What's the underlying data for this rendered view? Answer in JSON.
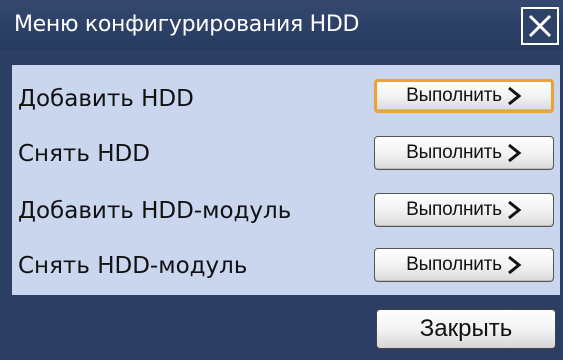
{
  "dialog": {
    "title": "Меню конфигурирования HDD",
    "close_icon": "close-x-icon"
  },
  "rows": [
    {
      "label": "Добавить HDD",
      "button": "Выполнить",
      "icon": "chevron-right-icon",
      "focused": true
    },
    {
      "label": "Снять HDD",
      "button": "Выполнить",
      "icon": "chevron-right-icon",
      "focused": false
    },
    {
      "label": "Добавить HDD-модуль",
      "button": "Выполнить",
      "icon": "chevron-right-icon",
      "focused": false
    },
    {
      "label": "Снять HDD-модуль",
      "button": "Выполнить",
      "icon": "chevron-right-icon",
      "focused": false
    }
  ],
  "footer": {
    "close_label": "Закрыть"
  },
  "colors": {
    "title_bar": "#2c3e63",
    "panel": "#c9d6ee",
    "focus_border": "#f0a230"
  }
}
